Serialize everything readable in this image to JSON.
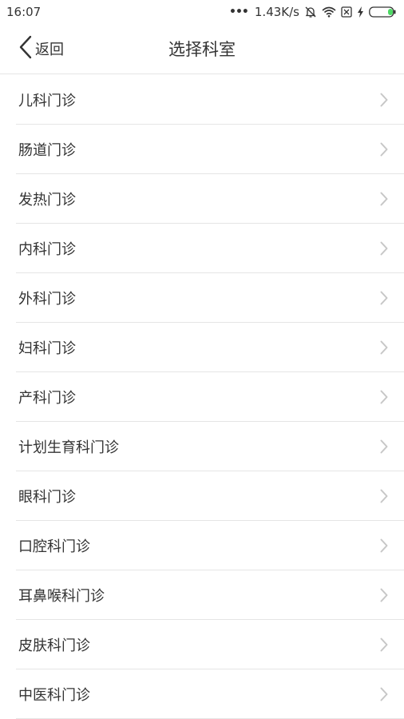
{
  "status_bar": {
    "time": "16:07",
    "dots": "•••",
    "network_speed": "1.43K/s",
    "icons": [
      "mute-bell-icon",
      "wifi-icon",
      "sim-x-icon",
      "charging-icon",
      "battery-icon"
    ]
  },
  "nav": {
    "back_label": "返回",
    "title": "选择科室"
  },
  "departments": [
    {
      "label": "儿科门诊"
    },
    {
      "label": "肠道门诊"
    },
    {
      "label": "发热门诊"
    },
    {
      "label": "内科门诊"
    },
    {
      "label": "外科门诊"
    },
    {
      "label": "妇科门诊"
    },
    {
      "label": "产科门诊"
    },
    {
      "label": "计划生育科门诊"
    },
    {
      "label": "眼科门诊"
    },
    {
      "label": "口腔科门诊"
    },
    {
      "label": "耳鼻喉科门诊"
    },
    {
      "label": "皮肤科门诊"
    },
    {
      "label": "中医科门诊"
    }
  ],
  "colors": {
    "text": "#333333",
    "divider": "#e5e5e5",
    "chevron": "#c7c7c7",
    "battery_fill": "#4cd964"
  }
}
